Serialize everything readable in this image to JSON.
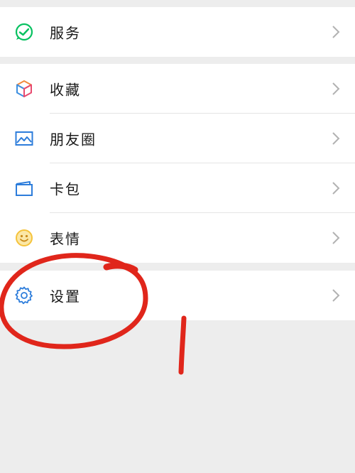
{
  "groups": [
    {
      "items": [
        {
          "label": "服务",
          "icon": "wechat-pay-icon"
        }
      ]
    },
    {
      "items": [
        {
          "label": "收藏",
          "icon": "favorites-cube-icon"
        },
        {
          "label": "朋友圈",
          "icon": "moments-picture-icon"
        },
        {
          "label": "卡包",
          "icon": "card-wallet-icon"
        },
        {
          "label": "表情",
          "icon": "emoji-smile-icon"
        }
      ]
    },
    {
      "items": [
        {
          "label": "设置",
          "icon": "gear-icon"
        }
      ]
    }
  ],
  "colors": {
    "background": "#ededed",
    "row": "#ffffff",
    "text": "#191919",
    "chevron": "#b2b2b2",
    "annotation": "#e0261b",
    "wechat_green": "#07c160",
    "icon_blue": "#2d7ddb",
    "emoji_yellow": "#f5c33b"
  }
}
